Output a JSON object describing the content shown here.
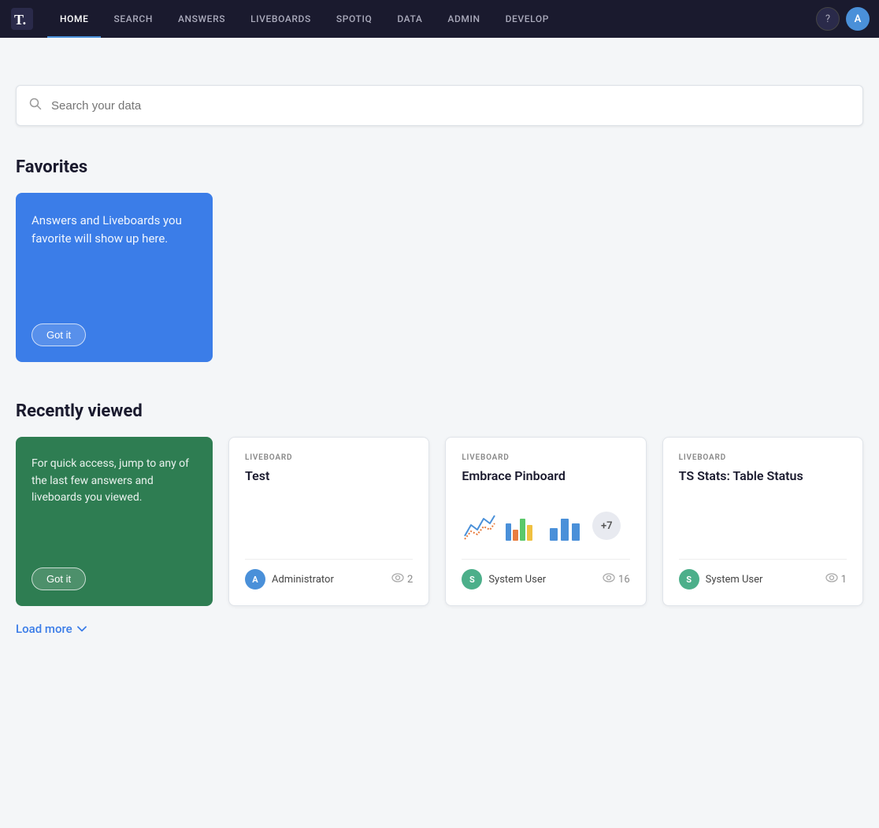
{
  "nav": {
    "logo": "T",
    "items": [
      {
        "label": "HOME",
        "active": true
      },
      {
        "label": "SEARCH",
        "active": false
      },
      {
        "label": "ANSWERS",
        "active": false
      },
      {
        "label": "LIVEBOARDS",
        "active": false
      },
      {
        "label": "SPOTIQ",
        "active": false
      },
      {
        "label": "DATA",
        "active": false
      },
      {
        "label": "ADMIN",
        "active": false
      },
      {
        "label": "DEVELOP",
        "active": false
      }
    ],
    "help_icon": "?",
    "avatar_label": "A"
  },
  "search": {
    "placeholder": "Search your data"
  },
  "favorites": {
    "title": "Favorites",
    "promo_text": "Answers and Liveboards you favorite will show up here.",
    "got_it_label": "Got it"
  },
  "recently_viewed": {
    "title": "Recently viewed",
    "intro_text": "For quick access, jump to any of the last few answers and liveboards you viewed.",
    "got_it_label": "Got it",
    "cards": [
      {
        "type": "LIVEBOARD",
        "name": "Test",
        "has_preview": false,
        "author_initial": "A",
        "author_color": "#4a90d9",
        "author_name": "Administrator",
        "views": 2
      },
      {
        "type": "LIVEBOARD",
        "name": "Embrace Pinboard",
        "has_preview": true,
        "plus_count": "+7",
        "author_initial": "S",
        "author_color": "#4caf8a",
        "author_name": "System User",
        "views": 16
      },
      {
        "type": "LIVEBOARD",
        "name": "TS Stats: Table Status",
        "has_preview": false,
        "author_initial": "S",
        "author_color": "#4caf8a",
        "author_name": "System User",
        "views": 1
      }
    ]
  },
  "load_more": {
    "label": "Load more"
  }
}
